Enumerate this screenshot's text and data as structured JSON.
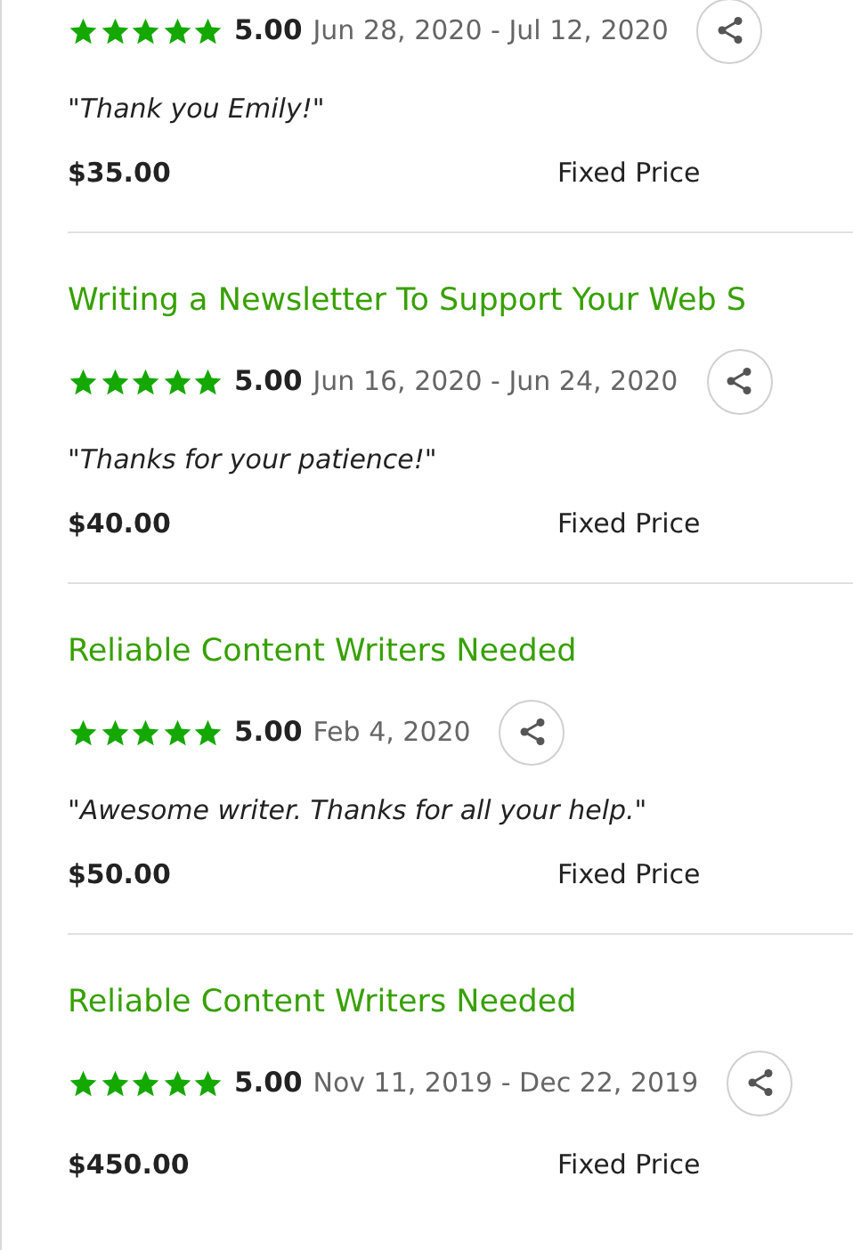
{
  "reviews": [
    {
      "stars": 5,
      "rating": "5.00",
      "dates": "Jun 28, 2020 - Jul 12, 2020",
      "quote": "\"Thank you Emily!\"",
      "price": "$35.00",
      "price_type": "Fixed Price"
    },
    {
      "title": "Writing a Newsletter To Support Your Web S",
      "stars": 5,
      "rating": "5.00",
      "dates": "Jun 16, 2020 - Jun 24, 2020",
      "quote": "\"Thanks for your patience!\"",
      "price": "$40.00",
      "price_type": "Fixed Price"
    },
    {
      "title": "Reliable Content Writers Needed",
      "stars": 5,
      "rating": "5.00",
      "dates": "Feb 4, 2020",
      "quote": "\"Awesome writer. Thanks for all your help.\"",
      "price": "$50.00",
      "price_type": "Fixed Price"
    },
    {
      "title": "Reliable Content Writers Needed",
      "stars": 5,
      "rating": "5.00",
      "dates": "Nov 11, 2019 - Dec 22, 2019",
      "price": "$450.00",
      "price_type": "Fixed Price"
    }
  ]
}
